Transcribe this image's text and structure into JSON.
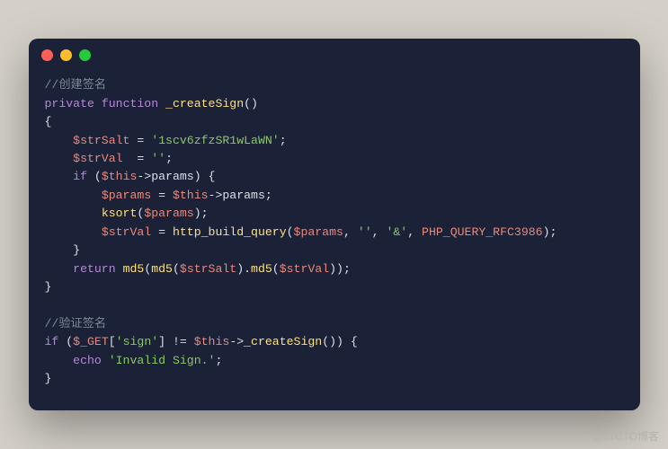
{
  "watermark": "@51CTO博客",
  "code": {
    "l1_cm": "//创建签名",
    "l2_kw1": "private",
    "l2_kw2": "function",
    "l2_fn": "_createSign",
    "l4_var": "$strSalt",
    "l4_str": "'1scv6zfzSR1wLaWN'",
    "l5_var": "$strVal",
    "l5_str": "''",
    "l6_kw": "if",
    "l6_var": "$this",
    "l6_prop": "params",
    "l7_var1": "$params",
    "l7_var2": "$this",
    "l7_prop": "params",
    "l8_fn": "ksort",
    "l8_var": "$params",
    "l9_var": "$strVal",
    "l9_fn": "http_build_query",
    "l9_arg1": "$params",
    "l9_str1": "''",
    "l9_str2": "'&'",
    "l9_cnst": "PHP_QUERY_RFC3986",
    "l11_kw": "return",
    "l11_fn1": "md5",
    "l11_fn2": "md5",
    "l11_var1": "$strSalt",
    "l11_fn3": "md5",
    "l11_var2": "$strVal",
    "l14_cm": "//验证签名",
    "l15_kw": "if",
    "l15_var1": "$_GET",
    "l15_str": "'sign'",
    "l15_var2": "$this",
    "l15_fn": "_createSign",
    "l16_kw": "echo",
    "l16_str": "'Invalid Sign.'"
  }
}
